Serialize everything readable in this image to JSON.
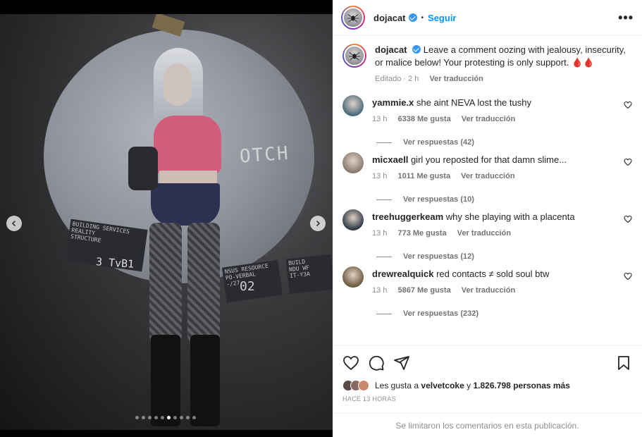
{
  "post": {
    "username": "dojacat",
    "separator": "•",
    "follow_label": "Seguir",
    "more_label": "•••"
  },
  "caption": {
    "username": "dojacat",
    "text": "Leave a comment oozing with jealousy, insecurity, or malice below! Your protesting is only support.",
    "emoji": "🩸🩸",
    "edited": "Editado · 2 h",
    "translate": "Ver traducción"
  },
  "comments": [
    {
      "user": "yammie.x",
      "text": "she aint NEVA lost the tushy",
      "time": "13 h",
      "likes": "6338 Me gusta",
      "translate": "Ver traducción",
      "replies": "Ver respuestas (42)",
      "color": "#4a6b7a"
    },
    {
      "user": "micxaell",
      "text": "girl you reposted for that damn slime...",
      "time": "13 h",
      "likes": "1011 Me gusta",
      "translate": "Ver traducción",
      "replies": "Ver respuestas (10)",
      "color": "#8a7a6e"
    },
    {
      "user": "treehuggerkeam",
      "text": "why she playing with a placenta",
      "time": "13 h",
      "likes": "773 Me gusta",
      "translate": "Ver traducción",
      "replies": "Ver respuestas (12)",
      "color": "#2f3a44"
    },
    {
      "user": "drewrealquick",
      "text": "red contacts ≠ sold soul btw",
      "time": "13 h",
      "likes": "5867 Me gusta",
      "translate": "Ver traducción",
      "replies": "Ver respuestas (232)",
      "color": "#6b5a3e"
    }
  ],
  "likes": {
    "prefix": "Les gusta a",
    "user": "velvetcoke",
    "middle": "y",
    "count": "1.826.798 personas más"
  },
  "time_ago": "HACE 13 HORAS",
  "comments_limited": "Se limitaron los comentarios en esta publicación.",
  "media": {
    "moon_text": "OTCH",
    "sign1": "BUILDING SERVICES\nREALITY\nSTRUCTURE",
    "sign2": "NSUS RESOURCE\nPO-VERBAL\n-/27",
    "sign3": "BUILD\nNDU WF\nIT-Y3A",
    "wall_text": "3 TvB1",
    "wall_num": "02",
    "carousel_total": 10,
    "carousel_active": 6
  },
  "colors": {
    "accent": "#0095f6",
    "verified": "#3897f0",
    "muted": "#8e8e8e"
  }
}
